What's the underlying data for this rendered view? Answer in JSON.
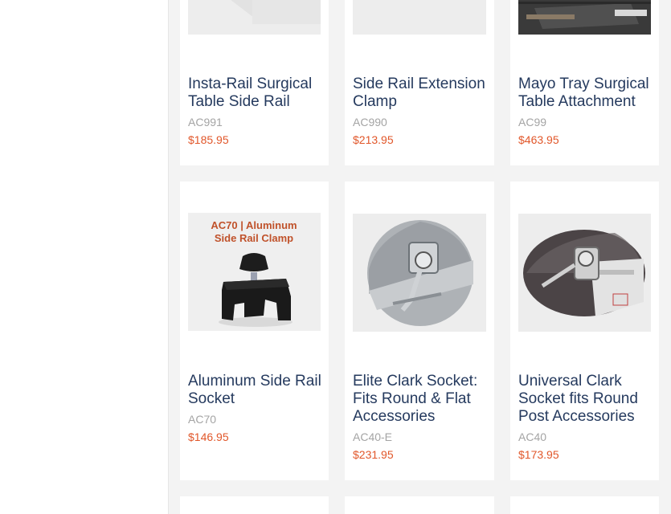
{
  "products": [
    {
      "title": "Insta-Rail Surgical Table Side Rail",
      "sku": "AC991",
      "price": "$185.95",
      "image_icon": "side-rail-image"
    },
    {
      "title": "Side Rail Extension Clamp",
      "sku": "AC990",
      "price": "$213.95",
      "image_icon": "extension-clamp-image"
    },
    {
      "title": "Mayo Tray Surgical Table Attachment",
      "sku": "AC99",
      "price": "$463.95",
      "image_icon": "mayo-tray-image"
    },
    {
      "title": "Aluminum Side Rail Socket",
      "sku": "AC70",
      "price": "$146.95",
      "image_icon": "aluminum-socket-image",
      "image_caption_line1": "AC70 | Aluminum",
      "image_caption_line2": "Side Rail Clamp"
    },
    {
      "title": "Elite Clark Socket: Fits Round & Flat Accessories",
      "sku": "AC40-E",
      "price": "$231.95",
      "image_icon": "elite-clark-socket-image"
    },
    {
      "title": "Universal Clark Socket fits Round Post Accessories",
      "sku": "AC40",
      "price": "$173.95",
      "image_icon": "universal-clark-socket-image"
    }
  ],
  "colors": {
    "title": "#253a5e",
    "sku": "#a4a4a4",
    "price": "#e1572a",
    "background": "#f3f3f3"
  }
}
